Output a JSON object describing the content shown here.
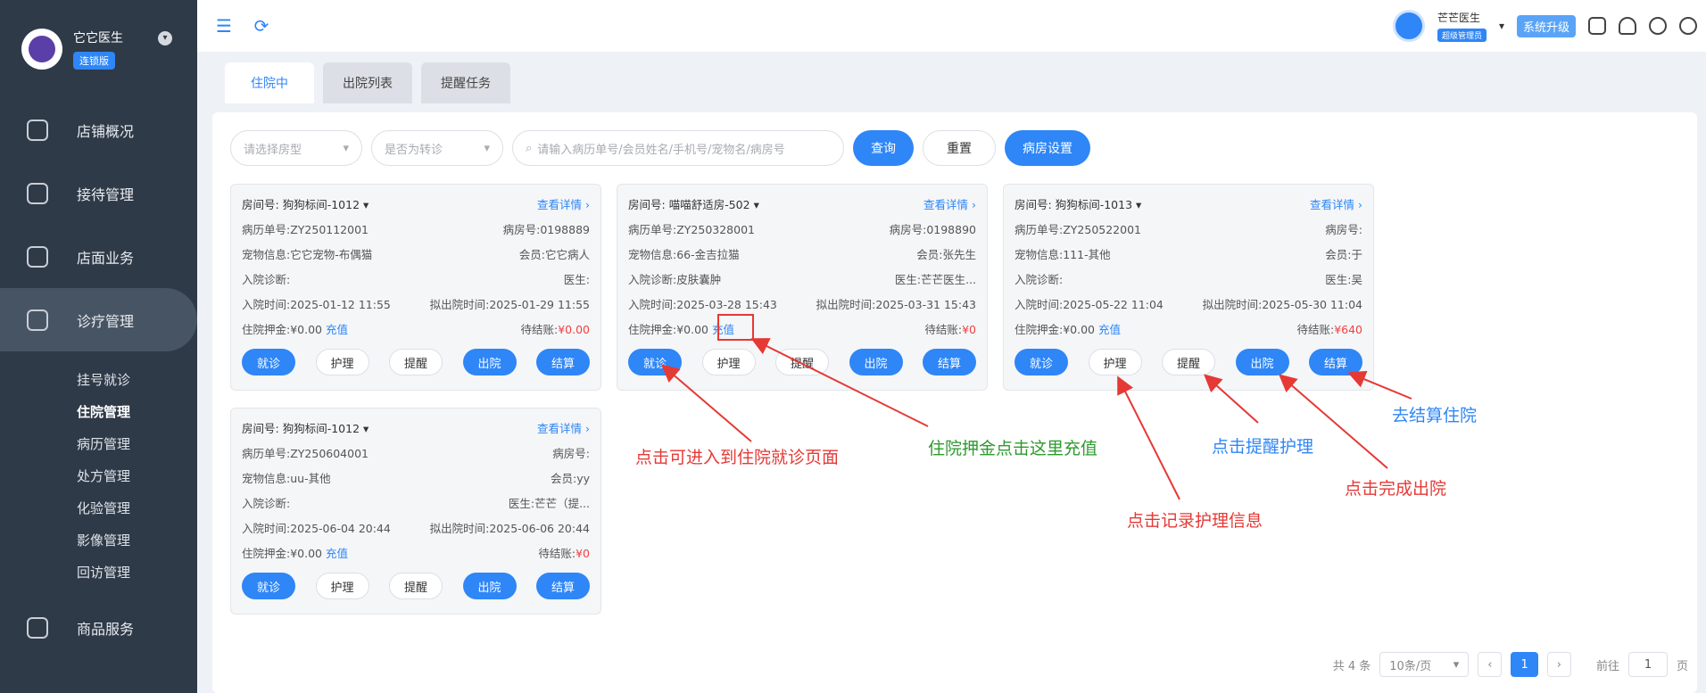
{
  "sidebar": {
    "brand_name": "它它医生",
    "brand_badge": "连锁版",
    "nav": [
      "店铺概况",
      "接待管理",
      "店面业务",
      "诊疗管理"
    ],
    "sub": [
      "挂号就诊",
      "住院管理",
      "病历管理",
      "处方管理",
      "化验管理",
      "影像管理",
      "回访管理"
    ],
    "bottom": "商品服务"
  },
  "header": {
    "user_name": "芒芒医生",
    "user_role": "超级管理员",
    "upgrade": "系统升级"
  },
  "tabs": [
    "住院中",
    "出院列表",
    "提醒任务"
  ],
  "filters": {
    "room_type": "请选择房型",
    "transfer": "是否为转诊",
    "search_placeholder": "请输入病历单号/会员姓名/手机号/宠物名/病房号",
    "query": "查询",
    "reset": "重置",
    "ward_settings": "病房设置"
  },
  "labels": {
    "room": "房间号:",
    "detail": "查看详情",
    "record": "病历单号:",
    "case": "病房号:",
    "pet": "宠物信息:",
    "member": "会员:",
    "diagnosis": "入院诊断:",
    "doctor": "医生:",
    "admit": "入院时间:",
    "plan": "拟出院时间:",
    "deposit": "住院押金:",
    "recharge": "充值",
    "pending": "待结账:",
    "btn_visit": "就诊",
    "btn_nursing": "护理",
    "btn_remind": "提醒",
    "btn_discharge": "出院",
    "btn_settle": "结算"
  },
  "cards": [
    {
      "room": "狗狗标间-1012",
      "record": "ZY250112001",
      "case": "0198889",
      "pet": "它它宠物-布偶猫",
      "member": "它它病人",
      "diagnosis": "",
      "doctor": "",
      "admit": "2025-01-12 11:55",
      "plan": "2025-01-29 11:55",
      "deposit": "¥0.00",
      "pending": "¥0.00"
    },
    {
      "room": "喵喵舒适房-502",
      "record": "ZY250328001",
      "case": "0198890",
      "pet": "66-金吉拉猫",
      "member": "张先生",
      "diagnosis": "皮肤囊肿",
      "doctor": "芒芒医生...",
      "admit": "2025-03-28 15:43",
      "plan": "2025-03-31 15:43",
      "deposit": "¥0.00",
      "pending": "¥0"
    },
    {
      "room": "狗狗标间-1013",
      "record": "ZY250522001",
      "case": "",
      "pet": "111-其他",
      "member": "于",
      "diagnosis": "",
      "doctor": "吴",
      "admit": "2025-05-22 11:04",
      "plan": "2025-05-30 11:04",
      "deposit": "¥0.00",
      "pending": "¥640"
    },
    {
      "room": "狗狗标间-1012",
      "record": "ZY250604001",
      "case": "",
      "pet": "uu-其他",
      "member": "yy",
      "diagnosis": "",
      "doctor": "芒芒（提...",
      "admit": "2025-06-04 20:44",
      "plan": "2025-06-06 20:44",
      "deposit": "¥0.00",
      "pending": "¥0"
    }
  ],
  "pager": {
    "total": "共 4 条",
    "size": "10条/页",
    "page": "1",
    "goto": "前往",
    "goto_val": "1",
    "unit": "页"
  },
  "annotations": {
    "a1": "点击可进入到住院就诊页面",
    "a2": "住院押金点击这里充值",
    "a3": "点击提醒护理",
    "a4": "去结算住院",
    "a5": "点击记录护理信息",
    "a6": "点击完成出院"
  },
  "colors": {
    "accent": "#2e86f7",
    "sidebar": "#2f3a48",
    "annotation_red": "#e53935",
    "annotation_green": "#2e9a2e",
    "annotation_blue": "#2e86f7"
  }
}
